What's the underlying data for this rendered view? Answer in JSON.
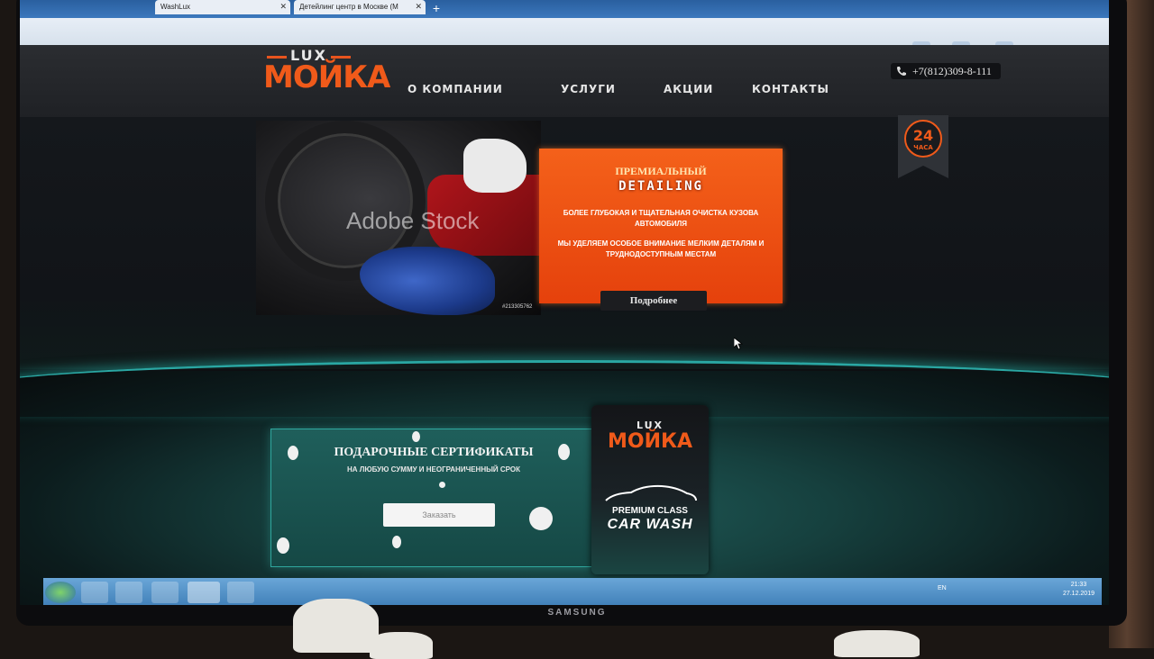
{
  "browser": {
    "tabs": [
      {
        "title": "WashLux"
      },
      {
        "title": "Детейлинг центр в Москве (М"
      }
    ]
  },
  "site": {
    "logo": {
      "top": "LUX",
      "main": "МОЙКА"
    },
    "nav": [
      {
        "label": "О компании"
      },
      {
        "label": "Услуги"
      },
      {
        "label": "Акции"
      },
      {
        "label": "Контакты"
      }
    ],
    "phone": "+7(812)309-8-111",
    "badge": {
      "number": "24",
      "label": "ЧАСА"
    }
  },
  "hero": {
    "watermark": "Adobe Stock",
    "stock_id": "#213305762",
    "promo": {
      "title": "ПРЕМИАЛЬНЫЙ",
      "subtitle": "DETAILING",
      "line1": "БОЛЕЕ ГЛУБОКАЯ И ТЩАТЕЛЬНАЯ ОЧИСТКА КУЗОВА АВТОМОБИЛЯ",
      "line2": "МЫ УДЕЛЯЕМ ОСОБОЕ ВНИМАНИЕ МЕЛКИМ ДЕТАЛЯМ И ТРУДНОДОСТУПНЫМ МЕСТАМ",
      "button": "Подробнее"
    }
  },
  "gift": {
    "title": "ПОДАРОЧНЫЕ СЕРТИФИКАТЫ",
    "subtitle": "НА ЛЮБУЮ СУММУ И НЕОГРАНИЧЕННЫЙ СРОК",
    "button": "Заказать"
  },
  "card": {
    "top": "LUX",
    "main": "МОЙКА",
    "line1": "PREMIUM CLASS",
    "line2": "CAR WASH"
  },
  "taskbar": {
    "lang": "EN",
    "time": "21:33",
    "date": "27.12.2019"
  },
  "monitor": {
    "brand": "SAMSUNG"
  },
  "colors": {
    "accent": "#f05a1a",
    "teal": "#2aa7a3",
    "promo": "#f4611a"
  }
}
